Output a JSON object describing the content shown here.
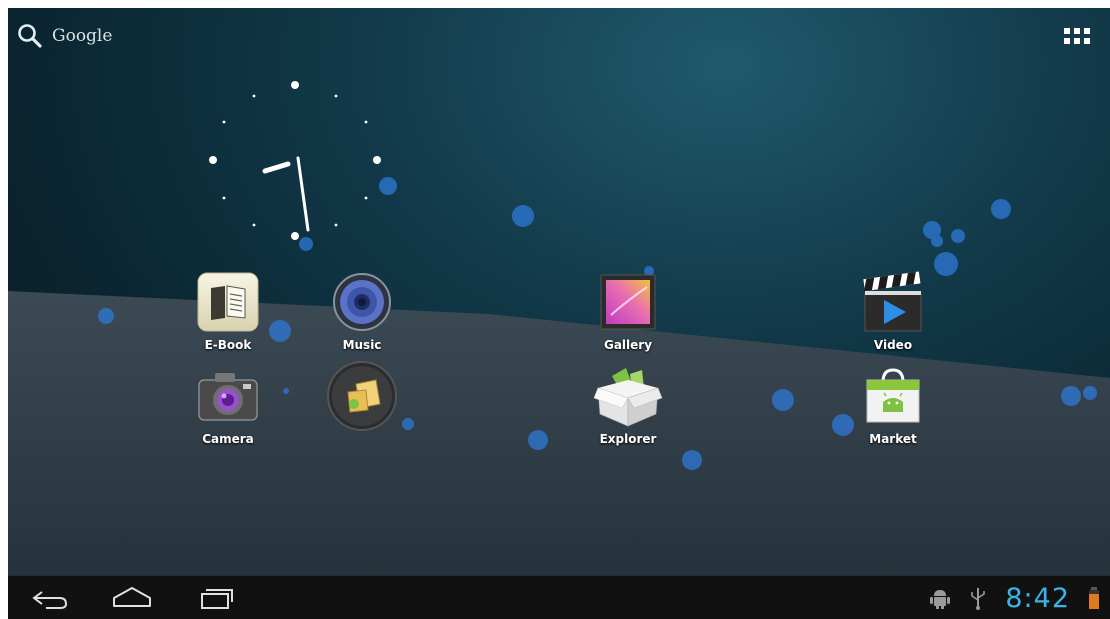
{
  "search": {
    "label": "Google"
  },
  "apps": [
    {
      "label": "E-Book",
      "icon": "ebook-icon"
    },
    {
      "label": "Music",
      "icon": "music-speaker-icon"
    },
    {
      "label": "Gallery",
      "icon": "gallery-icon"
    },
    {
      "label": "Video",
      "icon": "video-clapper-icon"
    },
    {
      "label": "Camera",
      "icon": "camera-icon"
    },
    {
      "label": "",
      "icon": "package-installer-icon"
    },
    {
      "label": "Explorer",
      "icon": "explorer-box-icon"
    },
    {
      "label": "Market",
      "icon": "market-bag-icon"
    }
  ],
  "status": {
    "time": "8:42"
  },
  "colors": {
    "accent": "#39b4e6",
    "navbar": "#111111",
    "battery": "#e07a20"
  }
}
